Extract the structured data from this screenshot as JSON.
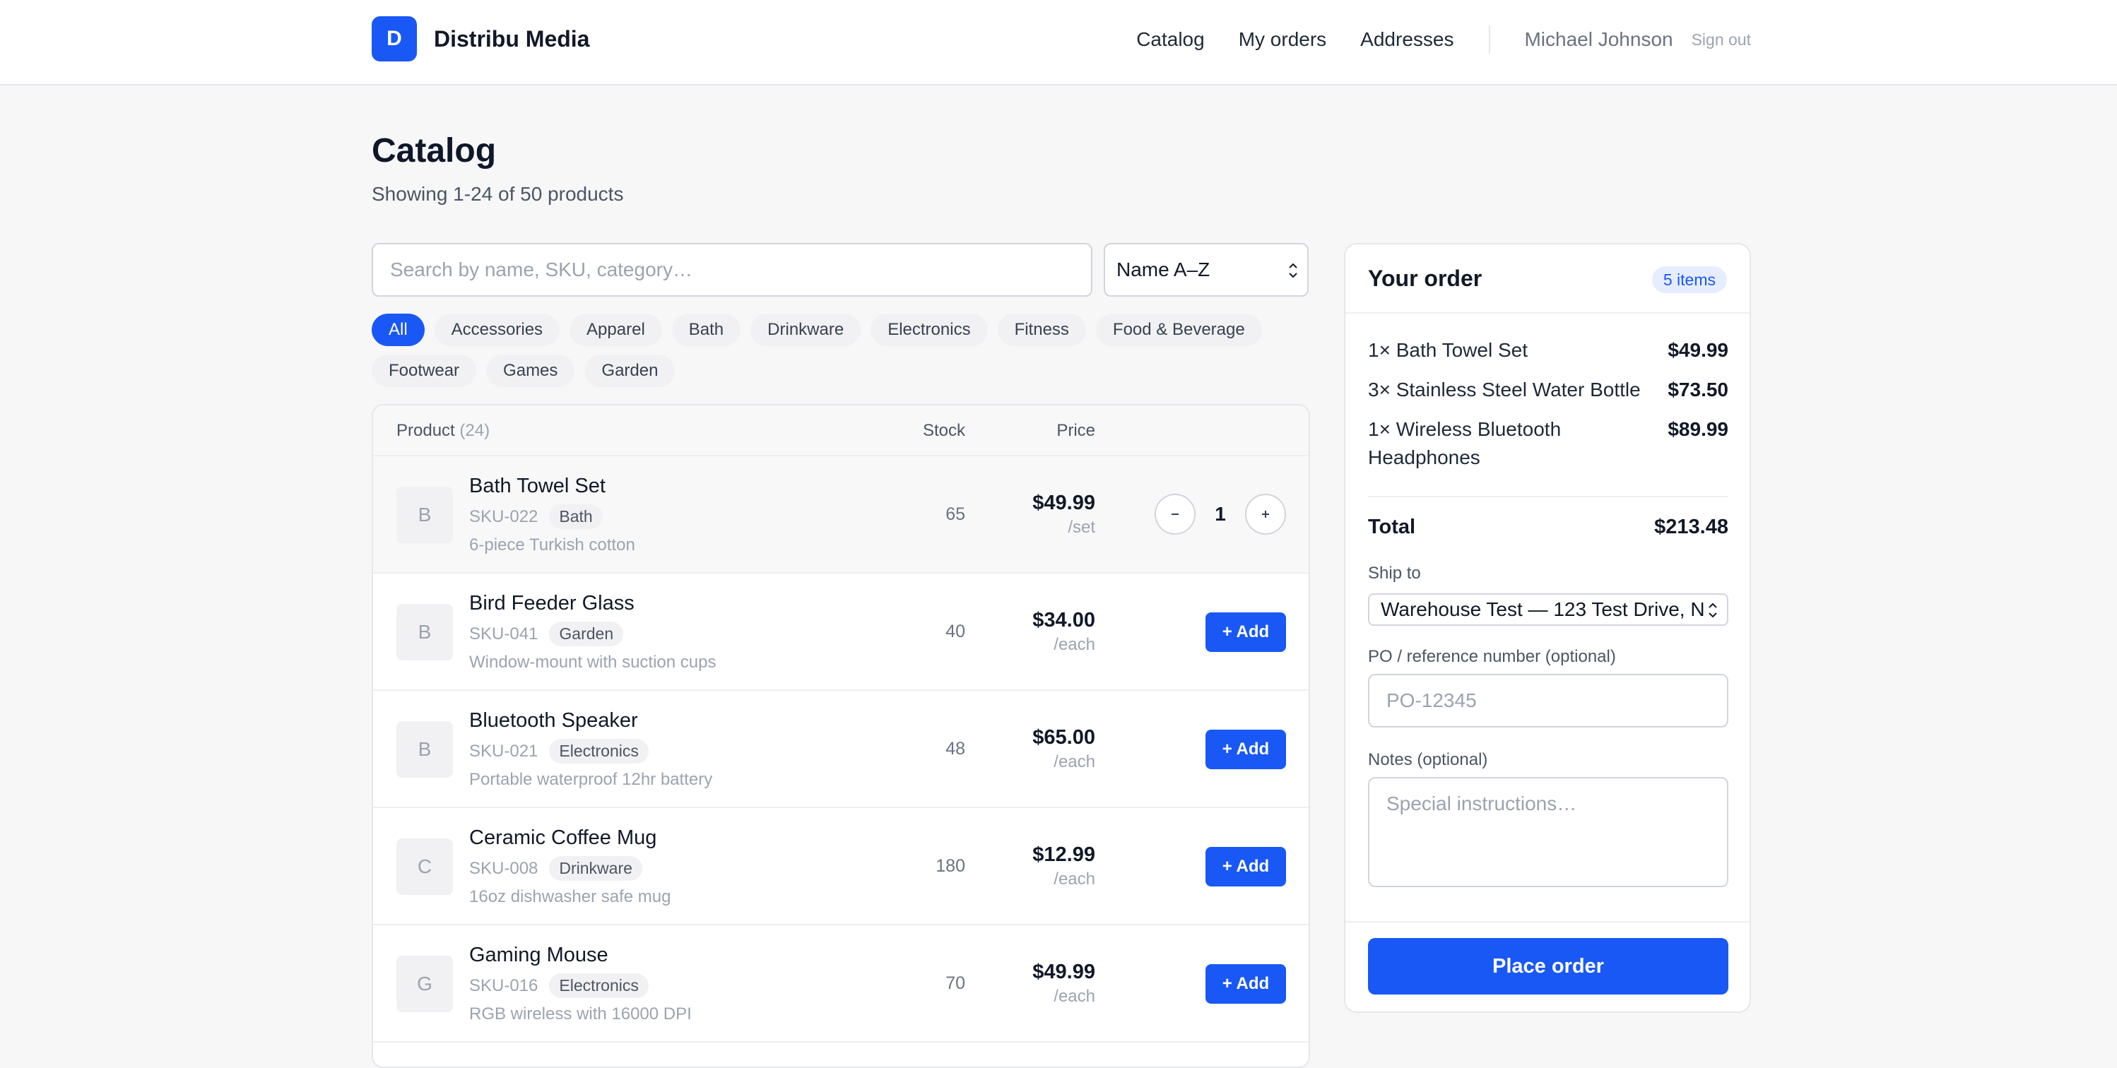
{
  "brand": {
    "logo_letter": "D",
    "name": "Distribu Media",
    "accent": "#1958f5"
  },
  "nav": {
    "items": [
      "Catalog",
      "My orders",
      "Addresses"
    ],
    "user": "Michael Johnson",
    "signout": "Sign out"
  },
  "page": {
    "title": "Catalog",
    "subtitle": "Showing 1-24 of 50 products"
  },
  "search": {
    "placeholder": "Search by name, SKU, category…",
    "value": ""
  },
  "sort": {
    "selected": "Name A–Z"
  },
  "categories": {
    "active": "All",
    "items": [
      "All",
      "Accessories",
      "Apparel",
      "Bath",
      "Drinkware",
      "Electronics",
      "Fitness",
      "Food & Beverage",
      "Footwear",
      "Games",
      "Garden"
    ]
  },
  "table": {
    "headers": {
      "product": "Product",
      "count": "(24)",
      "stock": "Stock",
      "price": "Price"
    },
    "add_label": "+ Add",
    "rows": [
      {
        "thumb": "B",
        "name": "Bath Towel Set",
        "sku": "SKU-022",
        "category": "Bath",
        "desc": "6-piece Turkish cotton",
        "stock": "65",
        "price": "$49.99",
        "unit": "/set",
        "qty": "1"
      },
      {
        "thumb": "B",
        "name": "Bird Feeder Glass",
        "sku": "SKU-041",
        "category": "Garden",
        "desc": "Window-mount with suction cups",
        "stock": "40",
        "price": "$34.00",
        "unit": "/each"
      },
      {
        "thumb": "B",
        "name": "Bluetooth Speaker",
        "sku": "SKU-021",
        "category": "Electronics",
        "desc": "Portable waterproof 12hr battery",
        "stock": "48",
        "price": "$65.00",
        "unit": "/each"
      },
      {
        "thumb": "C",
        "name": "Ceramic Coffee Mug",
        "sku": "SKU-008",
        "category": "Drinkware",
        "desc": "16oz dishwasher safe mug",
        "stock": "180",
        "price": "$12.99",
        "unit": "/each"
      },
      {
        "thumb": "G",
        "name": "Gaming Mouse",
        "sku": "SKU-016",
        "category": "Electronics",
        "desc": "RGB wireless with 16000 DPI",
        "stock": "70",
        "price": "$49.99",
        "unit": "/each"
      }
    ]
  },
  "order": {
    "title": "Your order",
    "badge": "5 items",
    "lines": [
      {
        "name": "1× Bath Towel Set",
        "price": "$49.99"
      },
      {
        "name": "3× Stainless Steel Water Bottle",
        "price": "$73.50"
      },
      {
        "name": "1× Wireless Bluetooth Headphones",
        "price": "$89.99"
      }
    ],
    "total_label": "Total",
    "total": "$213.48",
    "ship_label": "Ship to",
    "ship_value": "Warehouse Test — 123 Test Drive, N",
    "po_label": "PO / reference number (optional)",
    "po_placeholder": "PO-12345",
    "notes_label": "Notes (optional)",
    "notes_placeholder": "Special instructions…",
    "place_label": "Place order"
  }
}
